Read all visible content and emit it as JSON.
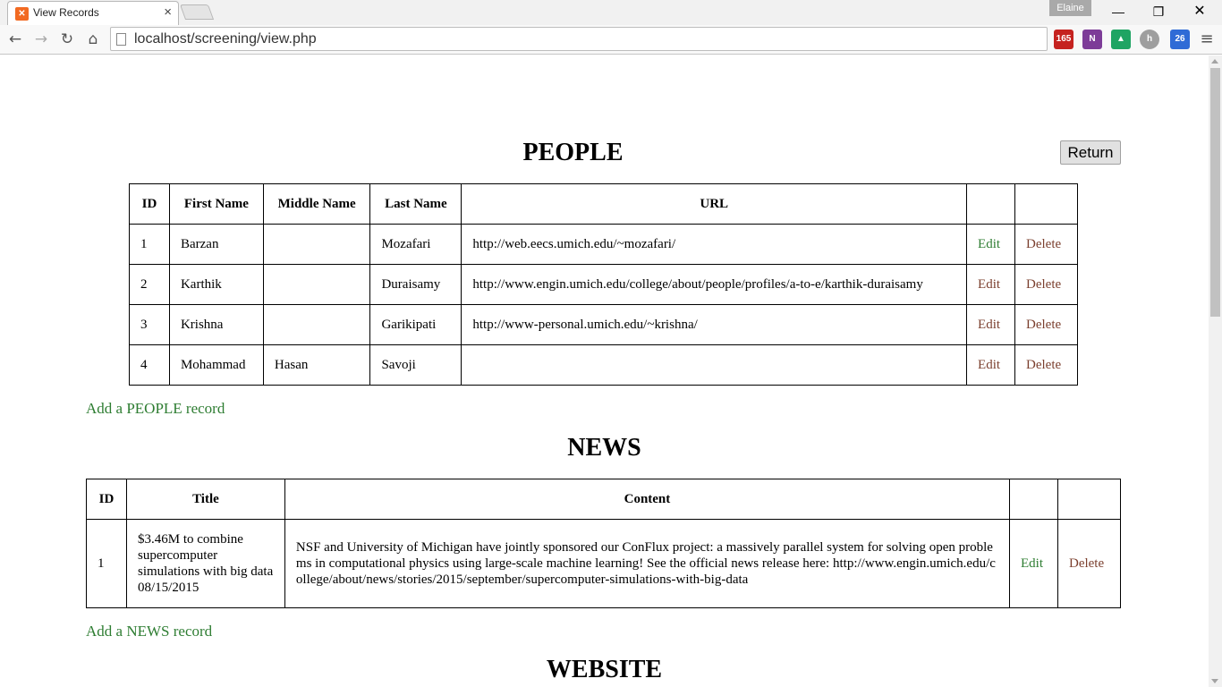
{
  "browser": {
    "tab_title": "View Records",
    "tab_close": "×",
    "profile_name": "Elaine",
    "url": "localhost/screening/view.php",
    "extensions": [
      {
        "name": "gmail-icon",
        "badge": "165",
        "color": "#c5221f"
      },
      {
        "name": "onenote-icon",
        "badge": "N",
        "color": "#7d3c98"
      },
      {
        "name": "drive-icon",
        "badge": "▲",
        "color": "#1fa463"
      },
      {
        "name": "h-icon",
        "badge": "h",
        "color": "#9e9e9e"
      },
      {
        "name": "screen-icon",
        "badge": "26",
        "color": "#2f6bd6"
      }
    ]
  },
  "page": {
    "people": {
      "heading": "PEOPLE",
      "return_label": "Return",
      "columns": [
        "ID",
        "First Name",
        "Middle Name",
        "Last Name",
        "URL",
        "",
        ""
      ],
      "rows": [
        {
          "id": "1",
          "first": "Barzan",
          "middle": "",
          "last": "Mozafari",
          "url": "http://web.eecs.umich.edu/~mozafari/"
        },
        {
          "id": "2",
          "first": "Karthik",
          "middle": "",
          "last": "Duraisamy",
          "url": "http://www.engin.umich.edu/college/about/people/profiles/a-to-e/karthik-duraisamy"
        },
        {
          "id": "3",
          "first": "Krishna",
          "middle": "",
          "last": "Garikipati",
          "url": "http://www-personal.umich.edu/~krishna/"
        },
        {
          "id": "4",
          "first": "Mohammad",
          "middle": "Hasan",
          "last": "Savoji",
          "url": ""
        }
      ],
      "edit_label": "Edit",
      "delete_label": "Delete",
      "add_label": "Add a PEOPLE record"
    },
    "news": {
      "heading": "NEWS",
      "columns": [
        "ID",
        "Title",
        "Content",
        "",
        ""
      ],
      "rows": [
        {
          "id": "1",
          "title": "$3.46M to combine supercomputer simulations with big data 08/15/2015",
          "content": "NSF and University of Michigan have jointly sponsored our ConFlux project: a massively parallel system for solving open problems in computational physics using large-scale machine learning! See the official news release here: http://www.engin.umich.edu/college/about/news/stories/2015/september/supercomputer-simulations-with-big-data"
        }
      ],
      "edit_label": "Edit",
      "delete_label": "Delete",
      "add_label": "Add a NEWS record"
    },
    "website": {
      "heading": "WEBSITE"
    }
  }
}
